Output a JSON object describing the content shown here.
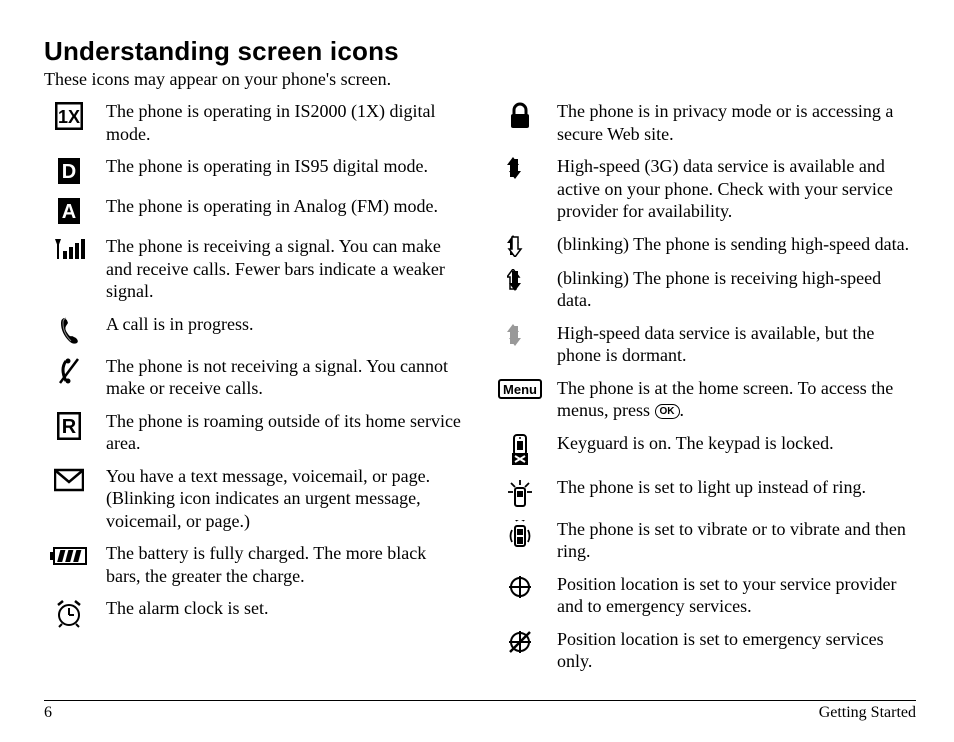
{
  "title": "Understanding screen icons",
  "intro": "These icons may appear on your phone's screen.",
  "ok_label": "OK",
  "left_items": [
    {
      "icon": "1x-icon",
      "desc": "The phone is operating in IS2000 (1X) digital mode."
    },
    {
      "icon": "d-icon",
      "desc": "The phone is operating in IS95 digital mode."
    },
    {
      "icon": "a-icon",
      "desc": "The phone is operating in Analog (FM) mode."
    },
    {
      "icon": "signal-icon",
      "desc": "The phone is receiving a signal. You can make and receive calls. Fewer bars indicate a weaker signal."
    },
    {
      "icon": "call-icon",
      "desc": "A call is in progress."
    },
    {
      "icon": "no-signal-icon",
      "desc": "The phone is not receiving a signal. You cannot make or receive calls."
    },
    {
      "icon": "r-icon",
      "desc": "The phone is roaming outside of its home service area."
    },
    {
      "icon": "message-icon",
      "desc": "You have a text message, voicemail, or page. (Blinking icon indicates an urgent message, voicemail, or page.)"
    },
    {
      "icon": "battery-icon",
      "desc": "The battery is fully charged. The more black bars, the greater the charge."
    },
    {
      "icon": "alarm-icon",
      "desc": "The alarm clock is set."
    }
  ],
  "right_items": [
    {
      "icon": "lock-icon",
      "desc": "The phone is in privacy mode or is accessing a secure Web site."
    },
    {
      "icon": "3g-icon",
      "desc": "High-speed (3G) data service is available and active on your phone. Check with your service provider for availability."
    },
    {
      "icon": "send-data-icon",
      "desc": "(blinking) The phone is sending high-speed data."
    },
    {
      "icon": "recv-data-icon",
      "desc": "(blinking) The phone is receiving high-speed data."
    },
    {
      "icon": "dormant-data-icon",
      "desc": "High-speed data service is available, but the phone is dormant."
    },
    {
      "icon": "menu-icon",
      "desc_special": "menu"
    },
    {
      "icon": "keyguard-icon",
      "desc": "Keyguard is on. The keypad is locked."
    },
    {
      "icon": "light-ring-icon",
      "desc": "The phone is set to light up instead of ring."
    },
    {
      "icon": "vibrate-icon",
      "desc": "The phone is set to vibrate or to vibrate and then ring."
    },
    {
      "icon": "location-full-icon",
      "desc": "Position location is set to your service provider and to emergency services."
    },
    {
      "icon": "location-emerg-icon",
      "desc": "Position location is set to emergency services only."
    }
  ],
  "menu_desc_before": "The phone is at the home screen. To access the menus, press ",
  "menu_desc_after": ".",
  "page_number": "6",
  "section": "Getting Started"
}
